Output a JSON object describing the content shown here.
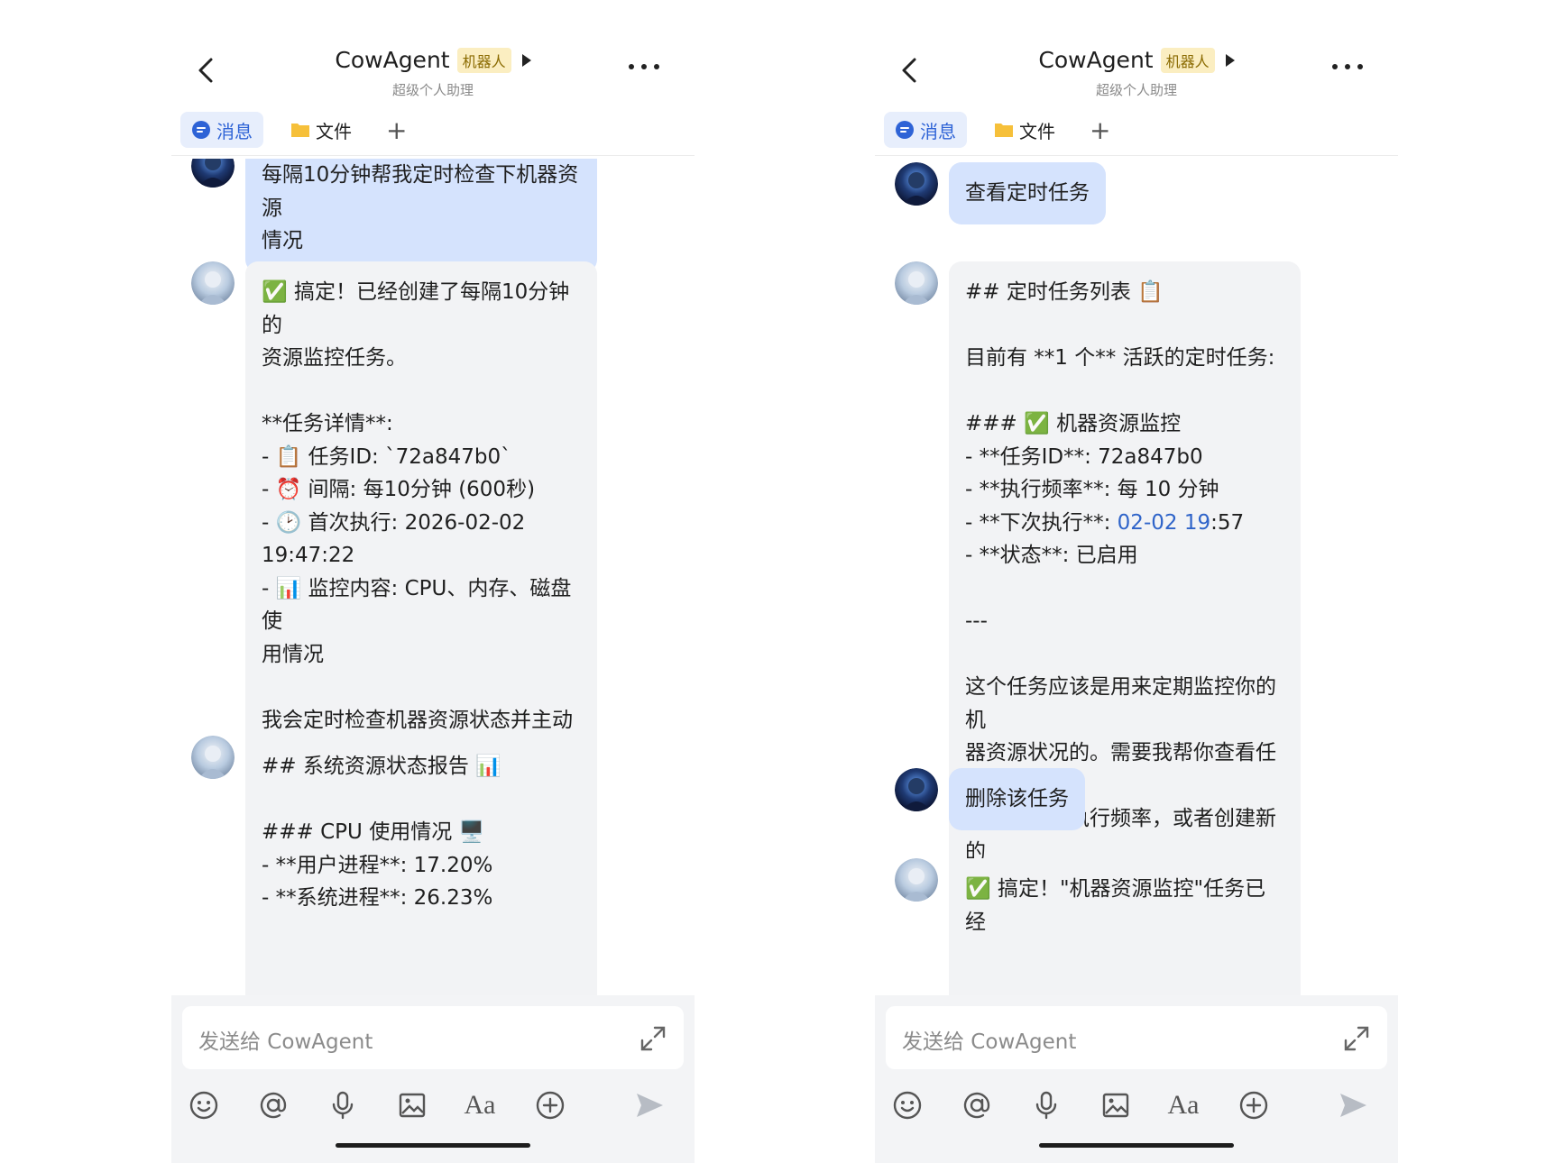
{
  "colors": {
    "user_bubble": "#d5e3fd",
    "bot_bubble": "#f2f3f5",
    "accent": "#2e63d6",
    "badge_bg": "#fbeec1"
  },
  "header": {
    "title": "CowAgent",
    "badge": "机器人",
    "subtitle": "超级个人助理"
  },
  "tabs": [
    {
      "label": "消息",
      "icon": "message-icon"
    },
    {
      "label": "文件",
      "icon": "folder-icon"
    }
  ],
  "composer": {
    "placeholder": "发送给 CowAgent"
  },
  "toolbar_icons": [
    "emoji-icon",
    "at-icon",
    "microphone-icon",
    "image-icon",
    "font-icon",
    "add-icon",
    "send-icon"
  ],
  "toolbar_labels": {
    "font": "Aa"
  },
  "left_chat": [
    {
      "role": "user",
      "text": "每隔10分钟帮我定时检查下机器资源\n情况"
    },
    {
      "role": "bot",
      "text": "✅ 搞定！已经创建了每隔10分钟的\n资源监控任务。\n\n**任务详情**:\n- 📋 任务ID: `72a847b0`\n- ⏰ 间隔: 每10分钟 (600秒)\n- 🕑 首次执行: 2026-02-02\n19:47:22\n- 📊 监控内容: CPU、内存、磁盘使\n用情况\n\n我会定时检查机器资源状态并主动向\n你报告。如果需要停止或修改这个任\n务，随时告诉我！🐮"
    },
    {
      "role": "bot",
      "text": "## 系统资源状态报告 📊\n\n### CPU 使用情况 🖥️\n- **用户进程**: 17.20%\n- **系统进程**: 26.23%"
    }
  ],
  "right_chat": [
    {
      "role": "user",
      "text": "查看定时任务"
    },
    {
      "role": "bot",
      "pre": "## 定时任务列表 📋\n\n目前有 **1 个** 活跃的定时任务:\n\n### ✅ 机器资源监控\n- **任务ID**: 72a847b0\n- **执行频率**: 每 10 分钟\n- **下次执行**: ",
      "link": "02-02 19",
      "post": ":57\n- **状态**: 已启用\n\n---\n\n这个任务应该是用来定期监控你的机\n器资源状况的。需要我帮你查看任务\n详情、修改执行频率，或者创建新的\n定时任务吗？ 🤔"
    },
    {
      "role": "user",
      "text": "删除该任务"
    },
    {
      "role": "bot",
      "text": "✅ 搞定！\"机器资源监控\"任务已经"
    }
  ]
}
